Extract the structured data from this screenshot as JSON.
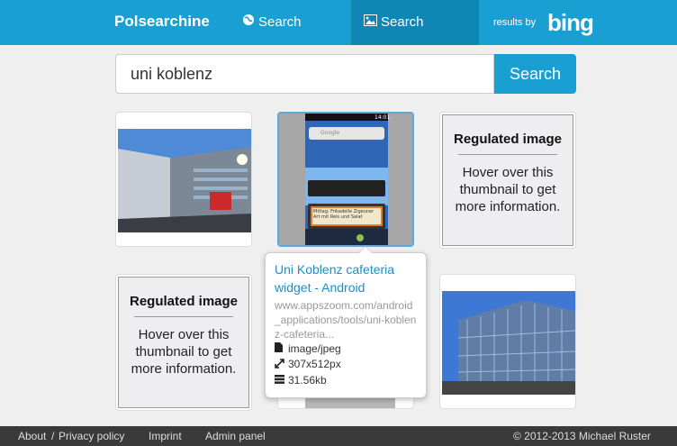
{
  "nav": {
    "brand": "Polsearchine",
    "pages": "Search pages",
    "images": "Search images",
    "results_by": "results by",
    "bing": "bing"
  },
  "search": {
    "query": "uni koblenz",
    "button": "Search"
  },
  "regulated": {
    "title": "Regulated image",
    "desc": "Hover over this thumbnail to get more information."
  },
  "tooltip": {
    "title": "Uni Koblenz cafeteria widget - Android",
    "url": "www.appszoom.com/android_applications/tools/uni-koblenz-cafeteria...",
    "type": "image/jpeg",
    "dims": "307x512px",
    "size": "31.56kb"
  },
  "phone": {
    "time": "14:01",
    "search_hint": "Google",
    "widget_text": "Mittag: Frikadelle Zigeuner Art mit Reis und Salat"
  },
  "footer": {
    "about": "About",
    "sep": "/",
    "privacy": "Privacy policy",
    "imprint": "Imprint",
    "admin": "Admin panel",
    "copyright": "© 2012-2013 Michael Ruster"
  },
  "colors": {
    "navbar": "#1a9fd3",
    "nav_active": "#0f86b5",
    "link": "#1a8fc9",
    "footer": "#3a3a3a"
  }
}
